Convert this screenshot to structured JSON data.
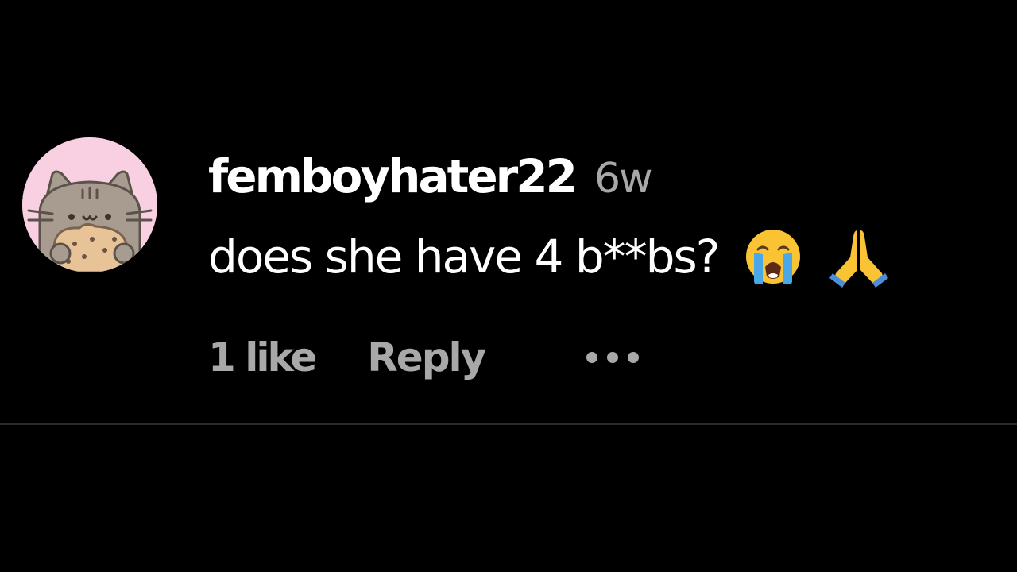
{
  "comment": {
    "username": "femboyhater22",
    "timestamp": "6w",
    "text": "does she have 4 b**bs?",
    "emojis": [
      "loudly-crying-face-icon",
      "folded-hands-icon"
    ],
    "likes": "1 like",
    "reply_label": "Reply",
    "more_icon": "more-options-icon",
    "avatar": "cat-avatar"
  },
  "colors": {
    "background": "#000000",
    "primary_text": "#ffffff",
    "secondary_text": "#a8a8a8",
    "divider": "#2a2a2a",
    "avatar_bg": "#f9cfe2"
  }
}
